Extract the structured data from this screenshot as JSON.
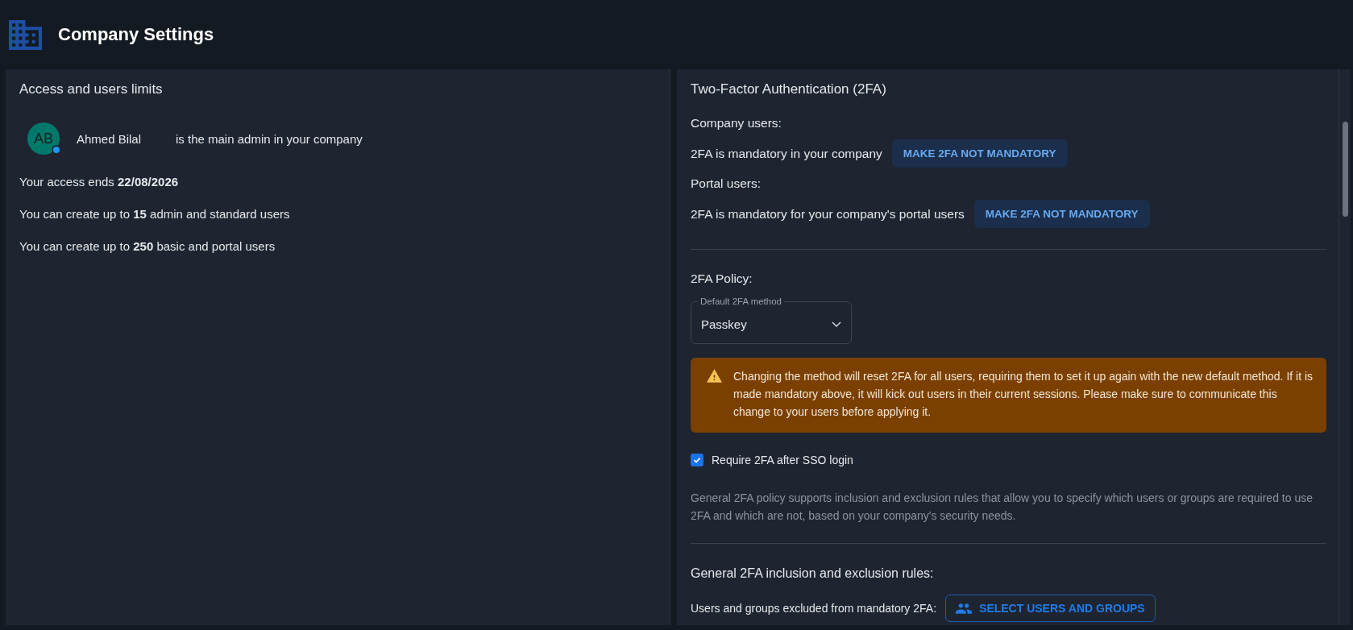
{
  "header": {
    "title": "Company Settings"
  },
  "access_panel": {
    "title": "Access and users limits",
    "admin": {
      "initials": "AB",
      "online": true,
      "name": "Ahmed Bilal",
      "note": "is the main admin in your company"
    },
    "lines": [
      "Your access ends **22/08/2026**",
      "You can create up to **15** admin and standard users",
      "You can create up to **250** basic and portal users"
    ]
  },
  "twofa_panel": {
    "title": "Two-Factor Authentication (2FA)",
    "groups": [
      {
        "heading": "Company users:",
        "status": "2FA is mandatory in your company",
        "button": "MAKE 2FA NOT MANDATORY"
      },
      {
        "heading": "Portal users:",
        "status": "2FA is mandatory for your company's portal users",
        "button": "MAKE 2FA NOT MANDATORY"
      }
    ],
    "policy": {
      "heading": "2FA Policy:",
      "method_select": {
        "label": "Default 2FA method",
        "value": "Passkey"
      },
      "warning": "Changing the method will reset 2FA for all users, requiring them to set it up again with the new default method. If it is made mandatory above, it will kick out users in their current sessions. Please make sure to communicate this change to your users before applying it.",
      "sso_checkbox": {
        "label": "Require 2FA after SSO login",
        "checked": true
      },
      "description": "General 2FA policy supports inclusion and exclusion rules that allow you to specify which users or groups are required to use 2FA and which are not, based on your company's security needs."
    },
    "rules": {
      "heading": "General 2FA inclusion and exclusion rules:",
      "excluded_label": "Users and groups excluded from mandatory 2FA:",
      "button": "SELECT USERS AND GROUPS"
    }
  }
}
